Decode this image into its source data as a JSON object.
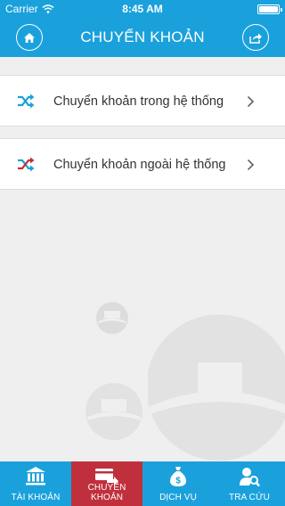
{
  "status_bar": {
    "carrier": "Carrier",
    "time": "8:45 AM"
  },
  "nav": {
    "title": "CHUYỂN KHOẢN",
    "left_icon": "home-icon",
    "right_icon": "share-icon"
  },
  "list": {
    "items": [
      {
        "label": "Chuyển khoản trong hệ thống",
        "icon": "shuffle-icon",
        "icon_color": "#1aa1dc"
      },
      {
        "label": "Chuyển khoản ngoài hệ thống",
        "icon": "shuffle-icon",
        "icon_color": "#c0303c"
      }
    ]
  },
  "tabs": [
    {
      "label": "TÀI KHOẢN",
      "icon": "bank-icon",
      "active": false
    },
    {
      "label": "CHUYỂN KHOẢN",
      "icon": "card-transfer-icon",
      "active": true
    },
    {
      "label": "DỊCH VỤ",
      "icon": "money-bag-icon",
      "active": false
    },
    {
      "label": "TRA CỨU",
      "icon": "user-search-icon",
      "active": false
    }
  ],
  "colors": {
    "brand": "#1aa1dc",
    "active_tab": "#c0303c",
    "background": "#efefef"
  }
}
